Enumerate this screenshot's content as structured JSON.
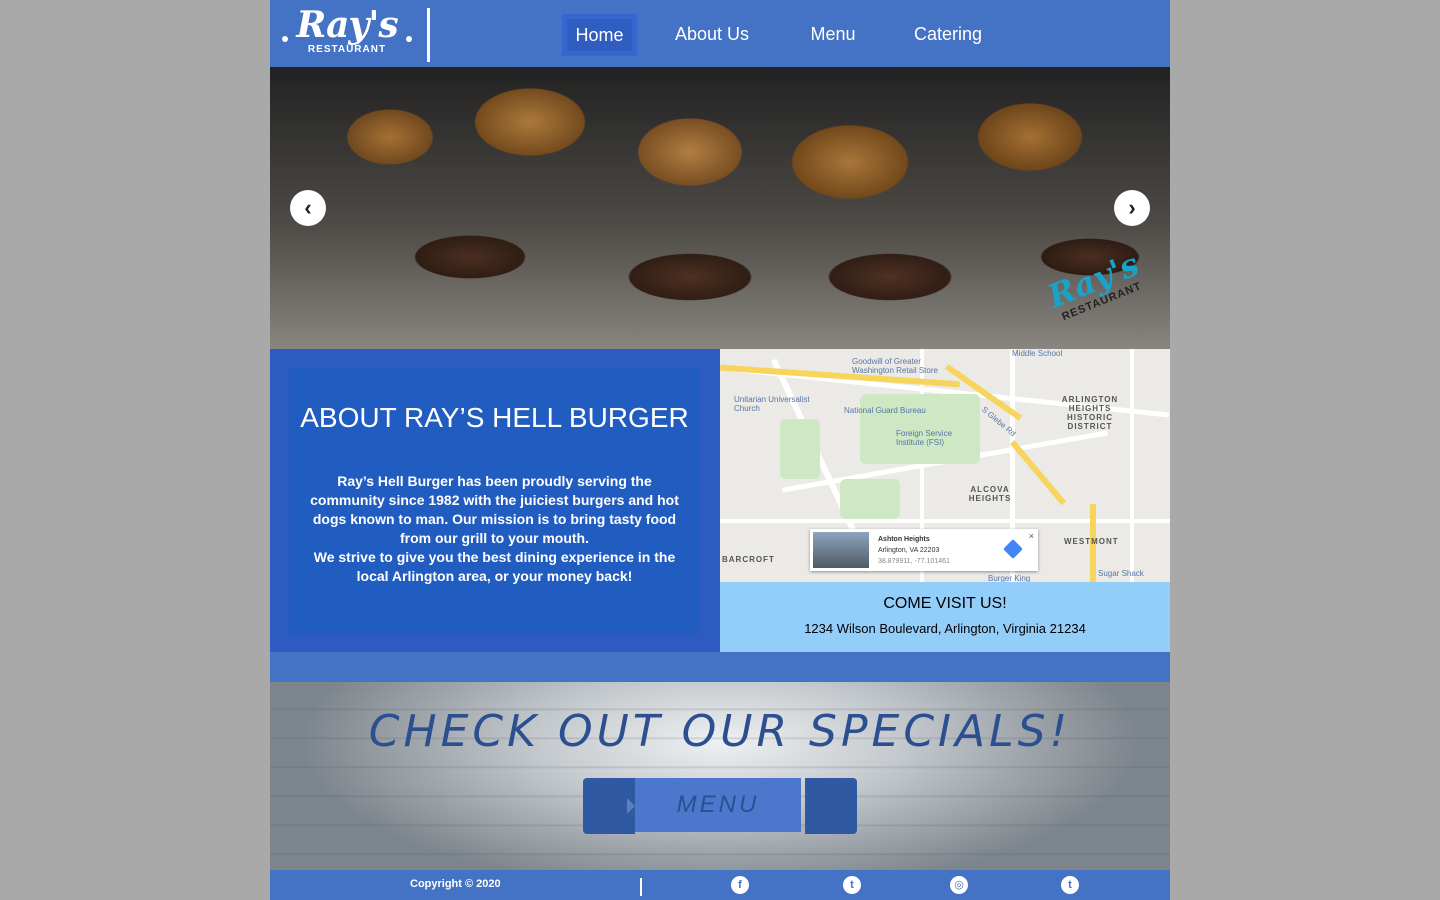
{
  "header": {
    "logo_script": "Ray's",
    "logo_sub": "RESTAURANT",
    "nav": [
      {
        "label": "Home",
        "active": true
      },
      {
        "label": "About Us",
        "active": false
      },
      {
        "label": "Menu",
        "active": false
      },
      {
        "label": "Catering",
        "active": false
      }
    ]
  },
  "hero": {
    "prev_icon": "‹",
    "next_icon": "›",
    "logo_script": "Ray's",
    "logo_sub": "RESTAURANT"
  },
  "about": {
    "title": "ABOUT RAY’S HELL BURGER",
    "text_1": "Ray’s Hell Burger has been proudly serving the community since 1982 with the juiciest burgers and hot dogs known to man. Our mission is to bring tasty food from our grill to your mouth.",
    "text_2": "We strive to give you the best dining experience in the local Arlington area, or your money back!"
  },
  "map": {
    "labels": {
      "goodwill": "Goodwill of Greater Washington Retail Store",
      "unitarian": "Unitarian Universalist Church",
      "national_guard": "National Guard Bureau",
      "foreign_service": "Foreign Service Institute (FSI)",
      "arlington_heights": "ARLINGTON HEIGHTS HISTORIC DISTRICT",
      "alcova": "ALCOVA HEIGHTS",
      "barcroft": "BARCROFT",
      "westmont": "WESTMONT",
      "middle_school": "Middle School",
      "sugar_shack": "Sugar Shack",
      "burger_king": "Burger King",
      "glebe": "S Glebe Rd"
    },
    "popup": {
      "name": "Ashton Heights",
      "address": "Arlington, VA 22203",
      "coords": "38.879911, -77.101461",
      "close": "×"
    }
  },
  "visit": {
    "title": "COME VISIT US!",
    "address": "1234 Wilson Boulevard, Arlington, Virginia 21234"
  },
  "specials": {
    "title": "CHECK OUT OUR SPECIALS!",
    "button": "MENU"
  },
  "footer": {
    "copyright": "Copyright  © 2020",
    "social": [
      {
        "name": "facebook-icon",
        "glyph": "f"
      },
      {
        "name": "twitter-icon",
        "glyph": "t"
      },
      {
        "name": "instagram-icon",
        "glyph": "◎"
      },
      {
        "name": "tumblr-icon",
        "glyph": "t"
      }
    ]
  },
  "colors": {
    "brand_blue": "#4472c4",
    "card_blue": "#215cc1",
    "visit_blue": "#93cdfa"
  }
}
